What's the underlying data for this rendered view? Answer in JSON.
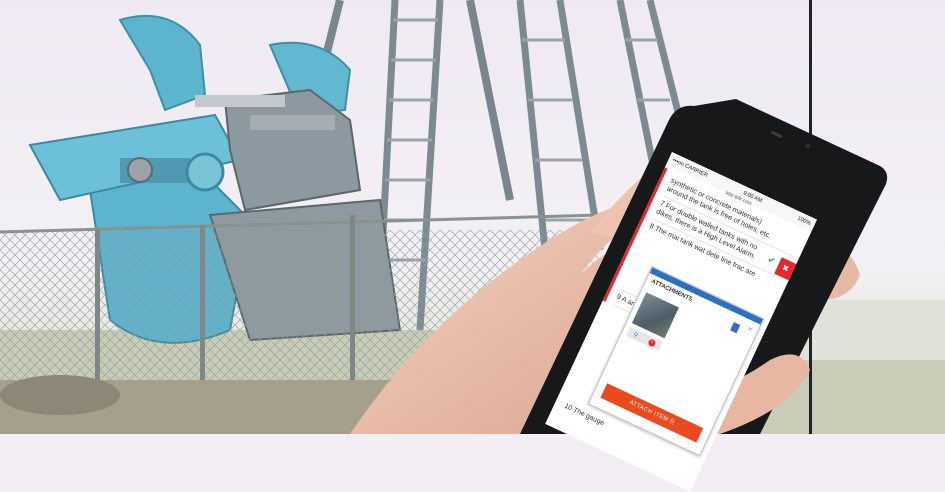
{
  "status_bar": {
    "carrier": "•••oo CARRIER",
    "time": "9:00 AM",
    "url": "app.ipllr.com",
    "battery": "100%"
  },
  "checklist": {
    "items": [
      {
        "text": "synthetic or concrete materials) around the tank is free of holes, etc."
      },
      {
        "text": "7 For double walled tanks with no dikes, there is a High Level Alarm."
      },
      {
        "text": "8 The mai tank wat dete line frac are"
      },
      {
        "text": "9 A are"
      }
    ],
    "bottom_text": "10 The gauge"
  },
  "attachments": {
    "title": "ATTACHMENTS",
    "close": "×",
    "button": "ATTACH ITEM"
  },
  "icons": {
    "check": "check-icon",
    "close": "close-icon",
    "document": "document-icon",
    "attach": "paperclip-icon",
    "zoom": "zoom-icon",
    "delete": "delete-icon"
  },
  "colors": {
    "accent_red": "#e4282d",
    "attach_orange": "#ea4a1e",
    "accent_blue": "#2d6fc1",
    "pumpjack_blue": "#5cb4cf"
  }
}
